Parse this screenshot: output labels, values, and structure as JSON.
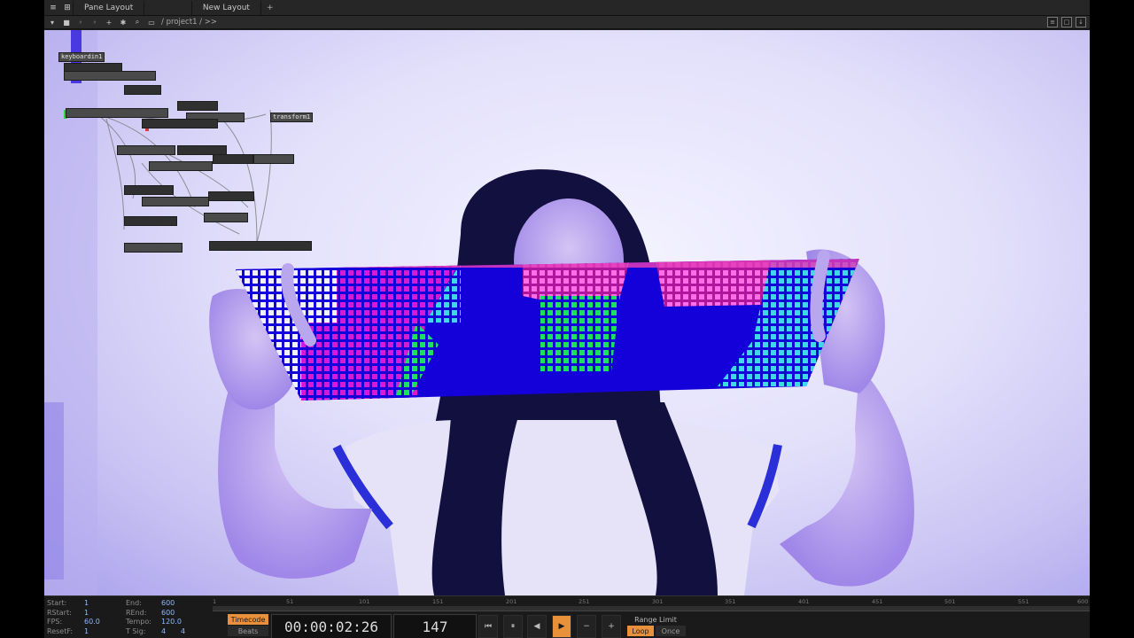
{
  "window": {
    "tabs": [
      "Pane Layout",
      "New Layout"
    ],
    "breadcrumb": "/ project1 / >>"
  },
  "network": {
    "nodes": [
      "keyboardin1",
      "transform1"
    ]
  },
  "timeline": {
    "start_label": "Start:",
    "start_value": "1",
    "rstart_label": "RStart:",
    "rstart_value": "1",
    "fps_label": "FPS:",
    "fps_value": "60.0",
    "resetf_label": "ResetF:",
    "resetf_value": "1",
    "end_label": "End:",
    "end_value": "600",
    "rend_label": "REnd:",
    "rend_value": "600",
    "tempo_label": "Tempo:",
    "tempo_value": "120.0",
    "tsig_label": "T Sig:",
    "tsig_value1": "4",
    "tsig_value2": "4",
    "ruler_ticks": [
      "1",
      "51",
      "101",
      "151",
      "201",
      "251",
      "301",
      "351",
      "401",
      "451",
      "501",
      "551",
      "600"
    ],
    "timecode_label": "Timecode",
    "beats_label": "Beats",
    "timecode": "00:00:02:26",
    "frame": "147",
    "range_limit_label": "Range Limit",
    "loop_label": "Loop",
    "once_label": "Once"
  },
  "colors": {
    "accent": "#e8903a",
    "pattern_blue": "#1400d8",
    "pattern_magenta": "#d21ad8",
    "pattern_green": "#1de060",
    "pattern_cyan": "#3fd8e8"
  }
}
